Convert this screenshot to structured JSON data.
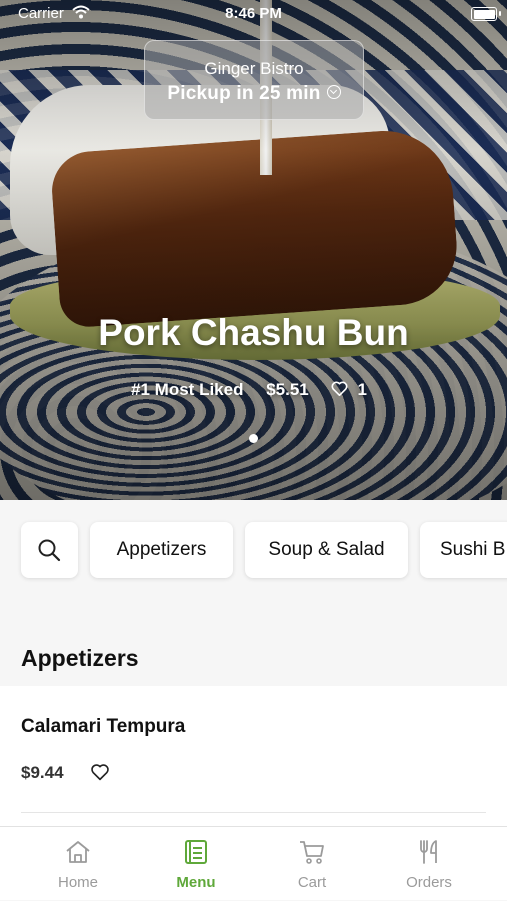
{
  "status_bar": {
    "carrier": "Carrier",
    "time": "8:46 PM"
  },
  "store": {
    "name": "Ginger Bistro",
    "pickup": "Pickup in 25 min"
  },
  "featured": {
    "title": "Pork Chashu Bun",
    "badge": "#1 Most Liked",
    "price": "$5.51",
    "likes": "1",
    "page_count": 1,
    "current_page": 1
  },
  "categories": [
    "Appetizers",
    "Soup & Salad",
    "Sushi B"
  ],
  "section": {
    "title": "Appetizers",
    "items": [
      {
        "name": "Calamari Tempura",
        "price": "$9.44"
      }
    ]
  },
  "tabs": [
    {
      "label": "Home",
      "icon": "home-icon",
      "active": false
    },
    {
      "label": "Menu",
      "icon": "menu-book-icon",
      "active": true
    },
    {
      "label": "Cart",
      "icon": "cart-icon",
      "active": false
    },
    {
      "label": "Orders",
      "icon": "fork-knife-icon",
      "active": false
    }
  ],
  "colors": {
    "accent": "#5fa83a",
    "inactive_tab": "#9b9b9b"
  }
}
